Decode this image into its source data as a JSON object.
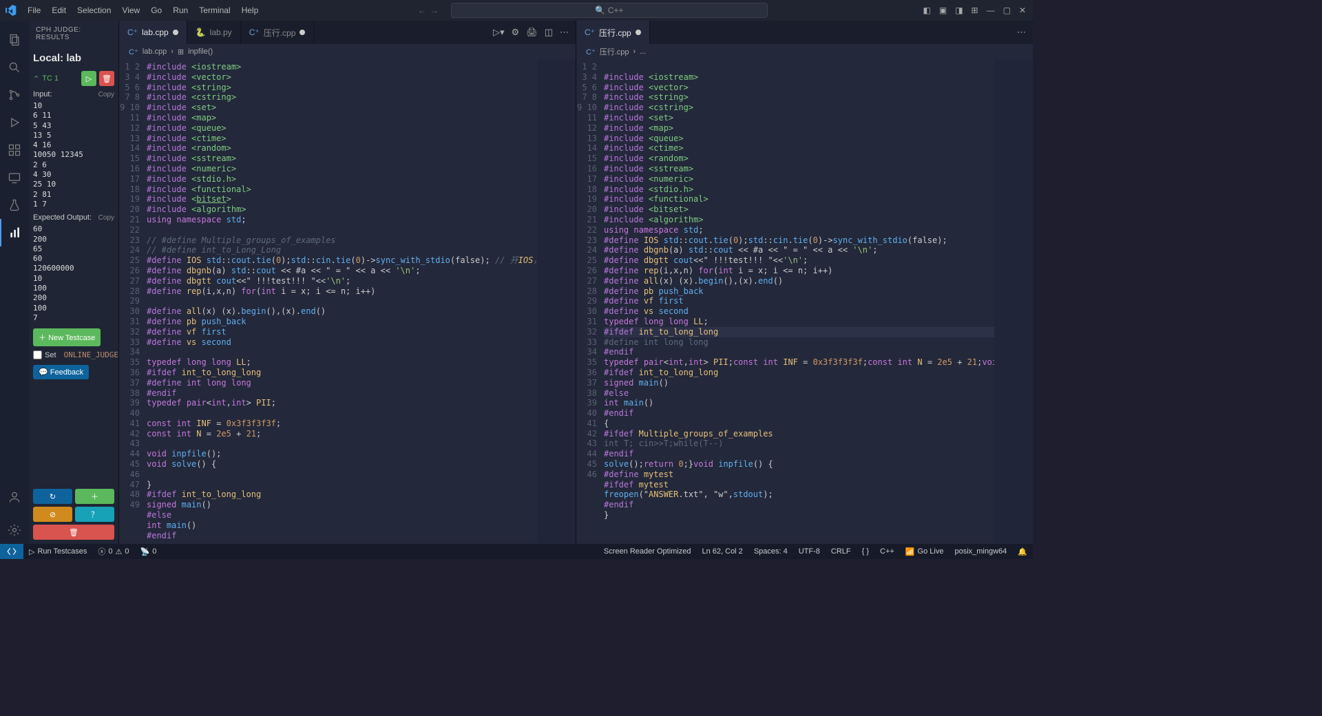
{
  "menu": {
    "items": [
      "File",
      "Edit",
      "Selection",
      "View",
      "Go",
      "Run",
      "Terminal",
      "Help"
    ],
    "search_placeholder": "C++"
  },
  "activity": [
    "files",
    "search",
    "git",
    "debug",
    "extensions",
    "remote",
    "beaker",
    "graph"
  ],
  "sidebar": {
    "title": "CPH JUDGE: RESULTS",
    "local": "Local: lab",
    "tc_label": "TC 1",
    "input_label": "Input:",
    "copy": "Copy",
    "input": "10\n6 11\n5 43\n13 5\n4 16\n10050 12345\n2 6\n4 30\n25 10\n2 81\n1 7",
    "expected_label": "Expected Output:",
    "expected": "60\n200\n65\n60\n120600000\n10\n100\n200\n100\n7",
    "new_tc": "New Testcase",
    "set_oj": "Set",
    "oj_code": "ONLINE_JUDGE",
    "feedback": "Feedback"
  },
  "left_editor": {
    "tabs": [
      {
        "icon": "cpp",
        "label": "lab.cpp",
        "active": true,
        "dirty": true
      },
      {
        "icon": "py",
        "label": "lab.py"
      },
      {
        "icon": "cpp",
        "label": "压行.cpp",
        "dirty": true
      }
    ],
    "breadcrumb": [
      "lab.cpp",
      "inpfile()"
    ],
    "lines": [
      "#include <iostream>",
      "#include <vector>",
      "#include <string>",
      "#include <cstring>",
      "#include <set>",
      "#include <map>",
      "#include <queue>",
      "#include <ctime>",
      "#include <random>",
      "#include <sstream>",
      "#include <numeric>",
      "#include <stdio.h>",
      "#include <functional>",
      "#include <bitset>",
      "#include <algorithm>",
      "using namespace std;",
      "",
      "// #define Multiple_groups_of_examples",
      "// #define int_to_Long_Long",
      "#define IOS std::cout.tie(0);std::cin.tie(0)->sync_with_stdio(false); // 开IOS，需要保证",
      "#define dbgnb(a) std::cout << #a << \" = \" << a << '\\n';",
      "#define dbgtt cout<<\" !!!test!!! \"<<'\\n';",
      "#define rep(i,x,n) for(int i = x; i <= n; i++)",
      "",
      "#define all(x) (x).begin(),(x).end()",
      "#define pb push_back",
      "#define vf first",
      "#define vs second",
      "",
      "typedef long long LL;",
      "#ifdef int_to_long_long",
      "#define int long long",
      "#endif",
      "typedef pair<int,int> PII;",
      "",
      "const int INF = 0x3f3f3f3f;",
      "const int N = 2e5 + 21;",
      "",
      "void inpfile();",
      "void solve() {",
      "",
      "}",
      "#ifdef int_to_long_long",
      "signed main()",
      "#else",
      "int main()",
      "#endif",
      "",
      "{"
    ]
  },
  "right_editor": {
    "tabs": [
      {
        "icon": "cpp",
        "label": "压行.cpp",
        "active": true,
        "dirty": true
      }
    ],
    "breadcrumb": [
      "压行.cpp",
      "..."
    ],
    "highlight": 27,
    "lines": [
      "",
      "#include <iostream>",
      "#include <vector>",
      "#include <string>",
      "#include <cstring>",
      "#include <set>",
      "#include <map>",
      "#include <queue>",
      "#include <ctime>",
      "#include <random>",
      "#include <sstream>",
      "#include <numeric>",
      "#include <stdio.h>",
      "#include <functional>",
      "#include <bitset>",
      "#include <algorithm>",
      "using namespace std;",
      "#define IOS std::cout.tie(0);std::cin.tie(0)->sync_with_stdio(false);",
      "#define dbgnb(a) std::cout << #a << \" = \" << a << '\\n';",
      "#define dbgtt cout<<\" !!!test!!! \"<<'\\n';",
      "#define rep(i,x,n) for(int i = x; i <= n; i++)",
      "#define all(x) (x).begin(),(x).end()",
      "#define pb push_back",
      "#define vf first",
      "#define vs second",
      "typedef long long LL;",
      "#ifdef int_to_long_long",
      "#define int long long",
      "#endif",
      "typedef pair<int,int> PII;const int INF = 0x3f3f3f3f;const int N = 2e5 + 21;void inpfile",
      "#ifdef int_to_long_long",
      "signed main()",
      "#else",
      "int main()",
      "#endif",
      "{",
      "#ifdef Multiple_groups_of_examples",
      "int T; cin>>T;while(T--)",
      "#endif",
      "solve();return 0;}void inpfile() {",
      "#define mytest",
      "#ifdef mytest",
      "freopen(\"ANSWER.txt\", \"w\",stdout);",
      "#endif",
      "}",
      ""
    ]
  },
  "status": {
    "run": "Run Testcases",
    "errors": "0",
    "warnings": "0",
    "ports": "0",
    "screen_reader": "Screen Reader Optimized",
    "lncol": "Ln 62, Col 2",
    "spaces": "Spaces: 4",
    "enc": "UTF-8",
    "eol": "CRLF",
    "lang_braces": "{ }",
    "lang": "C++",
    "golive": "Go Live",
    "host": "posix_mingw64"
  }
}
